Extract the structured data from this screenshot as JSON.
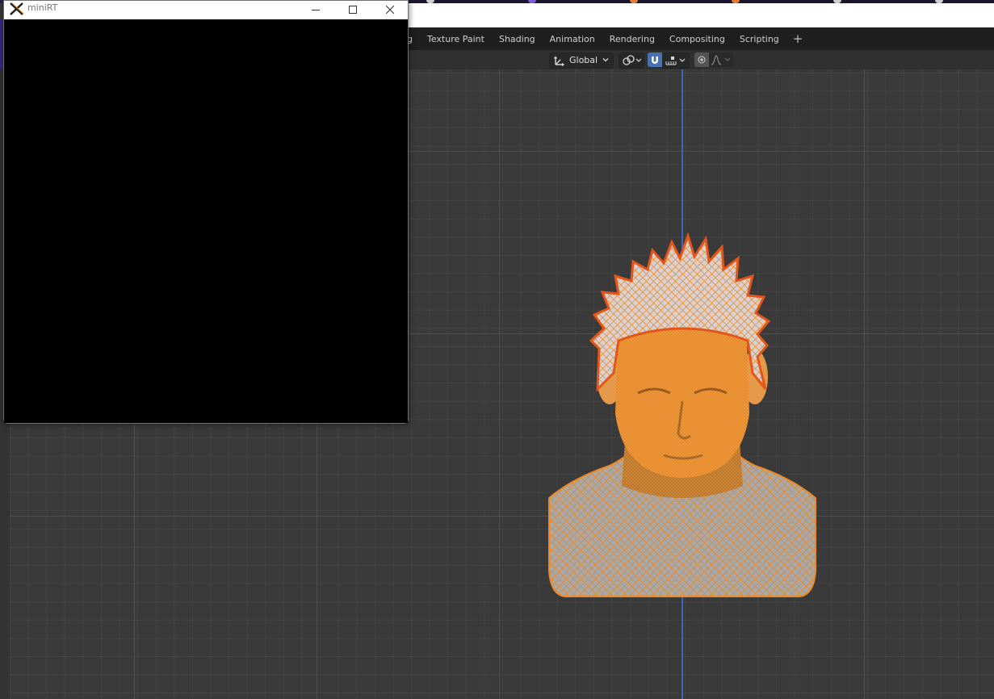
{
  "window": {
    "title": "miniRT",
    "logo_icon": "x-window-logo-icon"
  },
  "workspace": {
    "tabs": [
      {
        "label": "g"
      },
      {
        "label": "Texture Paint"
      },
      {
        "label": "Shading"
      },
      {
        "label": "Animation"
      },
      {
        "label": "Rendering"
      },
      {
        "label": "Compositing"
      },
      {
        "label": "Scripting"
      }
    ],
    "add_label": "+"
  },
  "header": {
    "orientation_label": "Global"
  },
  "colors": {
    "accent": "#4772b3",
    "mesh_orange": "#f08a24",
    "axis_z": "#3d67b8"
  }
}
